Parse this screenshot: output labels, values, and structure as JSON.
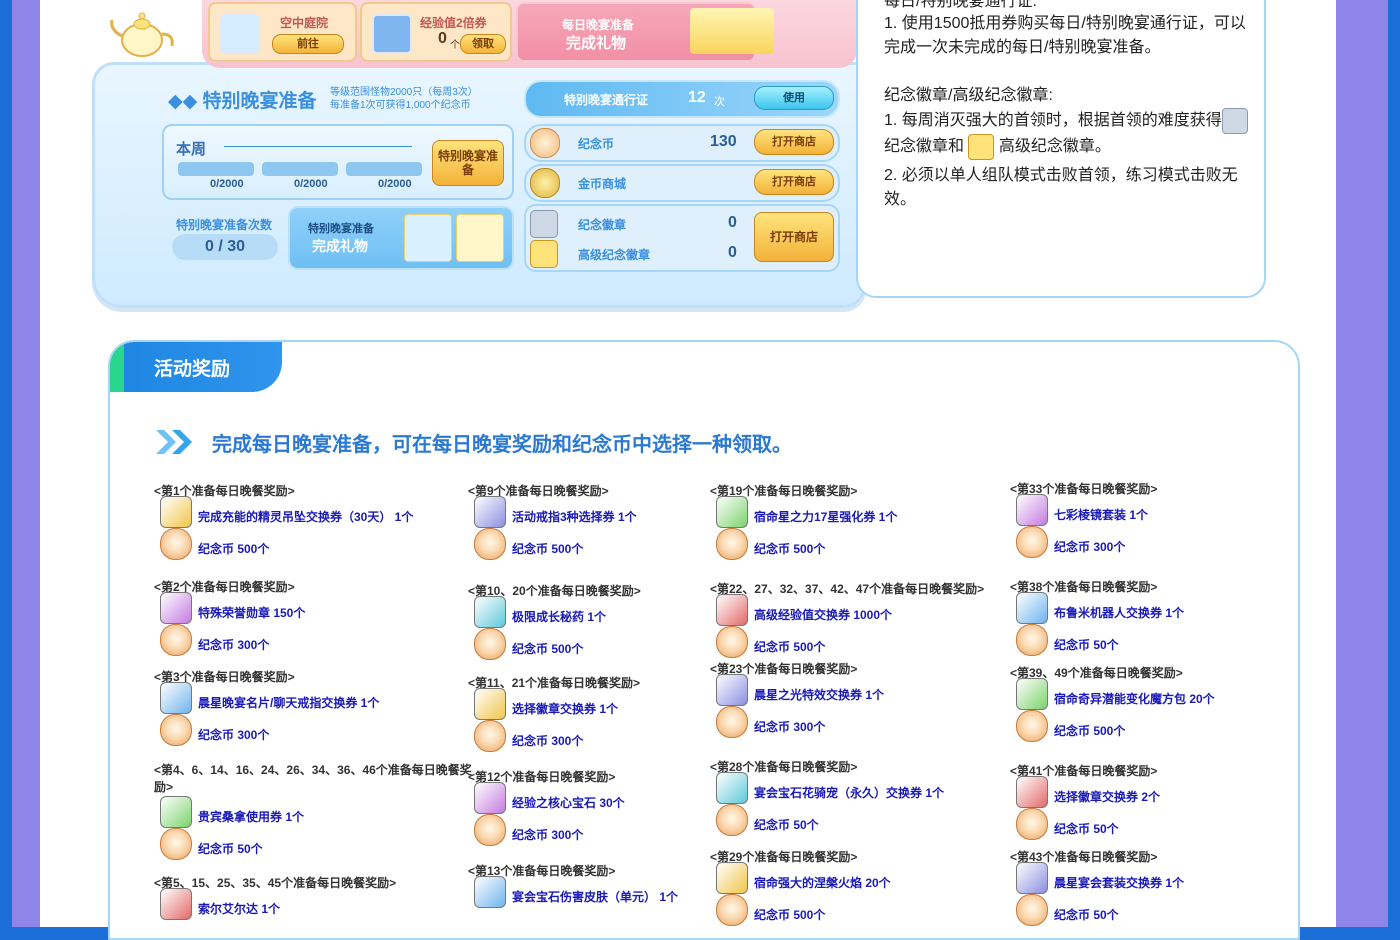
{
  "colors": {
    "frame": "#8d86e8",
    "outer": "#1c6fd8",
    "accent": "#2f7fd8",
    "link": "#1a1ab8"
  },
  "panel": {
    "top_cards": {
      "garden": {
        "label": "空中庭院",
        "button": "前往"
      },
      "exp": {
        "label": "经验值2倍券",
        "count": "0",
        "unit": "个",
        "button": "领取"
      },
      "daily_gift": {
        "line1": "每日晚宴准备",
        "line2": "完成礼物"
      }
    },
    "title": "◆◆ 特别晚宴准备",
    "subtitle1": "等级范围怪物2000只（每周3次）",
    "subtitle2": "每准备1次可获得1,000个纪念币",
    "week": {
      "label": "本周",
      "bars": [
        "0/2000",
        "0/2000",
        "0/2000"
      ],
      "button": "特别晚宴准备"
    },
    "count": {
      "label": "特别晚宴准备次数",
      "value": "0 / 30"
    },
    "gift": {
      "line1": "特别晚宴准备",
      "line2": "完成礼物"
    },
    "pass": {
      "label": "特别晚宴通行证",
      "value": "12",
      "unit": "次",
      "button": "使用"
    },
    "coin_row": {
      "label": "纪念币",
      "value": "130",
      "button": "打开商店"
    },
    "gold_row": {
      "label": "金币商城",
      "button": "打开商店"
    },
    "medal_row": {
      "label": "纪念徽章",
      "value": "0"
    },
    "high_medal_row": {
      "label": "高级纪念徽章",
      "value": "0"
    },
    "medal_button": "打开商店"
  },
  "info": {
    "line0": "每日/特别晚宴通行证:",
    "p1": "1. 使用1500抵用券购买每日/特别晚宴通行证，可以完成一次未完成的每日/特别晚宴准备。",
    "heading": "纪念徽章/高级纪念徽章:",
    "p2a": "1. 每周消灭强大的首领时，根据首领的难度获得",
    "p2b": "纪念徽章和",
    "p2c": "高级纪念徽章。",
    "p3": "2. 必须以单人组队模式击败首领，练习模式击败无效。"
  },
  "rewards": {
    "tab": "活动奖励",
    "headline": "完成每日晚宴准备，可在每日晚宴奖励和纪念币中选择一种领取。",
    "columns": [
      [
        {
          "title": "<第1个准备每日晚餐奖励>",
          "items": [
            "完成充能的精灵吊坠交换券（30天） 1个",
            "纪念币  500个"
          ]
        },
        {
          "title": "<第2个准备每日晚餐奖励>",
          "items": [
            "特殊荣誉勋章  150个",
            "纪念币  300个"
          ]
        },
        {
          "title": "<第3个准备每日晚餐奖励>",
          "items": [
            "晨星晚宴名片/聊天戒指交换券  1个",
            "纪念币  300个"
          ]
        },
        {
          "title": "<第4、6、14、16、24、26、34、36、46个准备每日晚餐奖励>",
          "items": [
            "贵宾桑拿使用券  1个",
            "纪念币  50个"
          ]
        },
        {
          "title": "<第5、15、25、35、45个准备每日晚餐奖励>",
          "items": [
            "索尔艾尔达  1个"
          ]
        }
      ],
      [
        {
          "title": "<第9个准备每日晚餐奖励>",
          "items": [
            "活动戒指3种选择券  1个",
            "纪念币  500个"
          ]
        },
        {
          "title": "<第10、20个准备每日晚餐奖励>",
          "items": [
            "极限成长秘药  1个",
            "纪念币  500个"
          ]
        },
        {
          "title": "<第11、21个准备每日晚餐奖励>",
          "items": [
            "选择徽章交换券  1个",
            "纪念币  300个"
          ]
        },
        {
          "title": "<第12个准备每日晚餐奖励>",
          "items": [
            "经验之核心宝石  30个",
            "纪念币  300个"
          ]
        },
        {
          "title": "<第13个准备每日晚餐奖励>",
          "items": [
            "宴会宝石伤害皮肤（单元）  1个"
          ]
        }
      ],
      [
        {
          "title": "<第19个准备每日晚餐奖励>",
          "items": [
            "宿命星之力17星强化券  1个",
            "纪念币  500个"
          ]
        },
        {
          "title": "<第22、27、32、37、42、47个准备每日晚餐奖励>",
          "items": [
            "高级经验值交换券  1000个",
            "纪念币  500个"
          ]
        },
        {
          "title": "<第23个准备每日晚餐奖励>",
          "items": [
            "晨星之光特效交换券  1个",
            "纪念币  300个"
          ]
        },
        {
          "title": "<第28个准备每日晚餐奖励>",
          "items": [
            "宴会宝石花骑宠（永久）交换券  1个",
            "纪念币  50个"
          ]
        },
        {
          "title": "<第29个准备每日晚餐奖励>",
          "items": [
            "宿命强大的涅槃火焰  20个",
            "纪念币  500个"
          ]
        }
      ],
      [
        {
          "title": "<第33个准备每日晚餐奖励>",
          "items": [
            "七彩棱镜套装  1个",
            "纪念币  300个"
          ]
        },
        {
          "title": "<第38个准备每日晚餐奖励>",
          "items": [
            "布鲁米机器人交换券  1个",
            "纪念币  50个"
          ]
        },
        {
          "title": "<第39、49个准备每日晚餐奖励>",
          "items": [
            "宿命奇异潜能变化魔方包  20个",
            "纪念币  500个"
          ]
        },
        {
          "title": "<第41个准备每日晚餐奖励>",
          "items": [
            "选择徽章交换券  2个",
            "纪念币  50个"
          ]
        },
        {
          "title": "<第43个准备每日晚餐奖励>",
          "items": [
            "晨星宴会套装交换券  1个",
            "纪念币  50个"
          ]
        }
      ]
    ]
  }
}
